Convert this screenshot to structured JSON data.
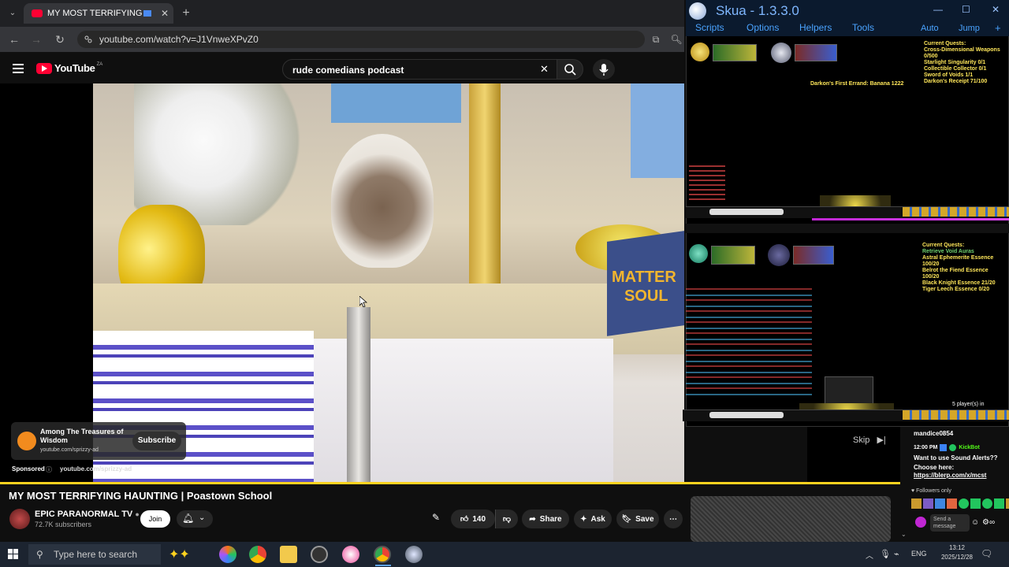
{
  "browser": {
    "tab_title": "MY MOST TERRIFYING HAU",
    "url": "youtube.com/watch?v=J1VnweXPvZ0"
  },
  "youtube": {
    "logo_text": "YouTube",
    "region_code": "ZA",
    "search_value": "rude comedians podcast"
  },
  "video": {
    "sign_text_1": "MATTER",
    "sign_text_2": "SOUL",
    "progress_fraction": 1.0,
    "skip_label": "Skip"
  },
  "ad": {
    "title": "Among The Treasures of Wisdom",
    "domain": "youtube.com/sprizzy-ad",
    "subscribe_label": "Subscribe",
    "sponsored_label": "Sponsored",
    "sponsored_domain": "youtube.com/sprizzy-ad"
  },
  "info": {
    "title": "MY MOST TERRIFYING HAUNTING | Poastown School",
    "channel": "EPIC PARANORMAL TV",
    "subscribers": "72.7K subscribers",
    "join_label": "Join",
    "likes": "140",
    "share_label": "Share",
    "ask_label": "Ask",
    "save_label": "Save"
  },
  "chat": {
    "top_user": "mandice0854",
    "time": "12:00 PM",
    "bot_name": "KickBot",
    "message_1": "Want to use Sound Alerts?? Choose here:",
    "link": "https://blerp.com/x/mcst",
    "followers_only": "Followers only",
    "send_placeholder": "Send a message"
  },
  "skua": {
    "title": "Skua - 1.3.3.0",
    "menu": [
      "Scripts",
      "Options",
      "Helpers",
      "Tools"
    ],
    "menu_right": [
      "Auto",
      "Jump"
    ],
    "pane1": {
      "quest_header": "Current Quests:",
      "quests": [
        "Cross-Dimensional Weapons 0/500",
        "Starlight Singularity 0/1",
        "Collectible Collector 0/1",
        "Sword of Voids 1/1",
        "Darkon's Receipt 71/100"
      ],
      "center_text": "Darkon's First Errand: Banana 1222"
    },
    "pane2": {
      "quest_header": "Current Quests:",
      "quests": [
        "Retrieve Void Auras",
        "Astral Ephemerite Essence 100/20",
        "Belrot the Fiend Essence 100/20",
        "Black Knight Essence 21/20",
        "Tiger Leech Essence 0/20"
      ],
      "players_label": "5 player(s) in"
    }
  },
  "taskbar": {
    "search_placeholder": "Type here to search",
    "language": "ENG",
    "time": "13:12",
    "date": "2025/12/28"
  },
  "colors": {
    "youtube_red": "#ff0033",
    "progress_yellow": "#ffd21f",
    "skua_blue": "#4aa3ff"
  }
}
